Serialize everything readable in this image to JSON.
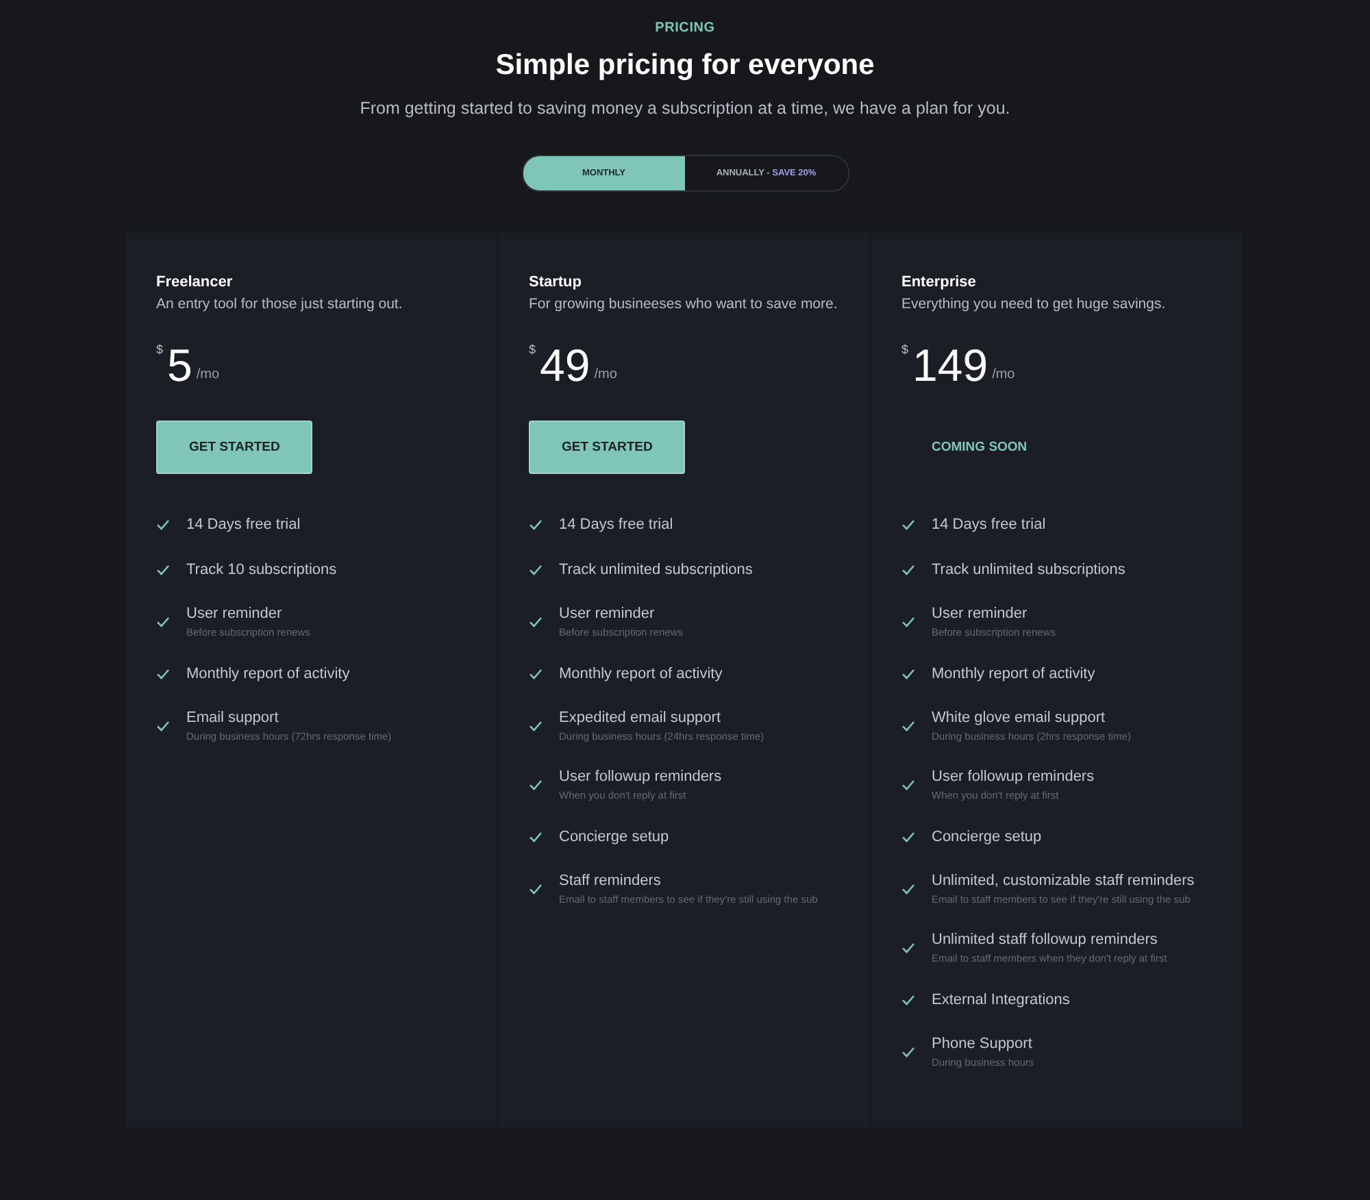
{
  "eyebrow": "PRICING",
  "title": "Simple pricing for everyone",
  "subtitle": "From getting started to saving money a subscription at a time, we have a plan for you.",
  "billing_toggle": [
    {
      "label": "MONTHLY",
      "selected": true
    },
    {
      "label": "ANNUALLY -",
      "note": "SAVE 20%",
      "selected": false
    }
  ],
  "plans": [
    {
      "name": "Freelancer",
      "description": "An entry tool for those just starting out.",
      "currency": "$",
      "price": "5",
      "period": "/mo",
      "action": {
        "kind": "filled",
        "label": "GET STARTED"
      },
      "features": [
        {
          "title": "14 Days free trial"
        },
        {
          "title": "Track 10 subscriptions"
        },
        {
          "title": "User reminder",
          "detail": "Before subscription renews"
        },
        {
          "title": "Monthly report of activity"
        },
        {
          "title": "Email support",
          "detail": "During business hours (72hrs response time)"
        }
      ]
    },
    {
      "name": "Startup",
      "description": "For growing busineeses who want to save more.",
      "currency": "$",
      "price": "49",
      "period": "/mo",
      "action": {
        "kind": "filled",
        "label": "GET STARTED"
      },
      "features": [
        {
          "title": "14 Days free trial"
        },
        {
          "title": "Track unlimited subscriptions"
        },
        {
          "title": "User reminder",
          "detail": "Before subscription renews"
        },
        {
          "title": "Monthly report of activity"
        },
        {
          "title": "Expedited email support",
          "detail": "During business hours (24hrs response time)"
        },
        {
          "title": "User followup reminders",
          "detail": "When you don't reply at first"
        },
        {
          "title": "Concierge setup"
        },
        {
          "title": "Staff reminders",
          "detail": "Email to staff members to see if they're still using the sub"
        }
      ]
    },
    {
      "name": "Enterprise",
      "description": "Everything you need to get huge savings.",
      "currency": "$",
      "price": "149",
      "period": "/mo",
      "action": {
        "kind": "text",
        "label": "COMING SOON"
      },
      "features": [
        {
          "title": "14 Days free trial"
        },
        {
          "title": "Track unlimited subscriptions"
        },
        {
          "title": "User reminder",
          "detail": "Before subscription renews"
        },
        {
          "title": "Monthly report of activity"
        },
        {
          "title": "White glove email support",
          "detail": "During business hours (2hrs response time)"
        },
        {
          "title": "User followup reminders",
          "detail": "When you don't reply at first"
        },
        {
          "title": "Concierge setup"
        },
        {
          "title": "Unlimited, customizable staff reminders",
          "detail": "Email to staff members to see if they're still using the sub"
        },
        {
          "title": "Unlimited staff followup reminders",
          "detail": "Email to staff members when they don't reply at first"
        },
        {
          "title": "External Integrations"
        },
        {
          "title": "Phone Support",
          "detail": "During business hours"
        }
      ]
    }
  ]
}
